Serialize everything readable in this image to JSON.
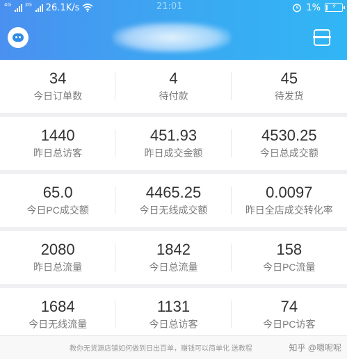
{
  "status_bar": {
    "network_tag_1": "4G",
    "network_tag_2": "2G",
    "speed": "26.1K/s",
    "time": "21:01",
    "battery": "1%"
  },
  "header": {
    "title": ""
  },
  "stats": [
    {
      "value": "34",
      "label": "今日订单数"
    },
    {
      "value": "4",
      "label": "待付款"
    },
    {
      "value": "45",
      "label": "待发货"
    },
    {
      "value": "1440",
      "label": "昨日总访客"
    },
    {
      "value": "451.93",
      "label": "昨日成交金额"
    },
    {
      "value": "4530.25",
      "label": "今日总成交额"
    },
    {
      "value": "65.0",
      "label": "今日PC成交额"
    },
    {
      "value": "4465.25",
      "label": "今日无线成交额"
    },
    {
      "value": "0.0097",
      "label": "昨日全店成交转化率"
    },
    {
      "value": "2080",
      "label": "昨日总流量"
    },
    {
      "value": "1842",
      "label": "今日总流量"
    },
    {
      "value": "158",
      "label": "今日PC流量"
    },
    {
      "value": "1684",
      "label": "今日无线流量"
    },
    {
      "value": "1131",
      "label": "今日总访客"
    },
    {
      "value": "74",
      "label": "今日PC访客"
    }
  ],
  "footer": {
    "tip": "教你无货源店铺如何做到日出百单，赚钱可以简单化 送教程",
    "watermark": "知乎 @嗯呢呢"
  },
  "colors": {
    "header_start": "#4a90f0",
    "header_end": "#31b6f5",
    "value_text": "#333333",
    "label_text": "#7a7a7a"
  }
}
